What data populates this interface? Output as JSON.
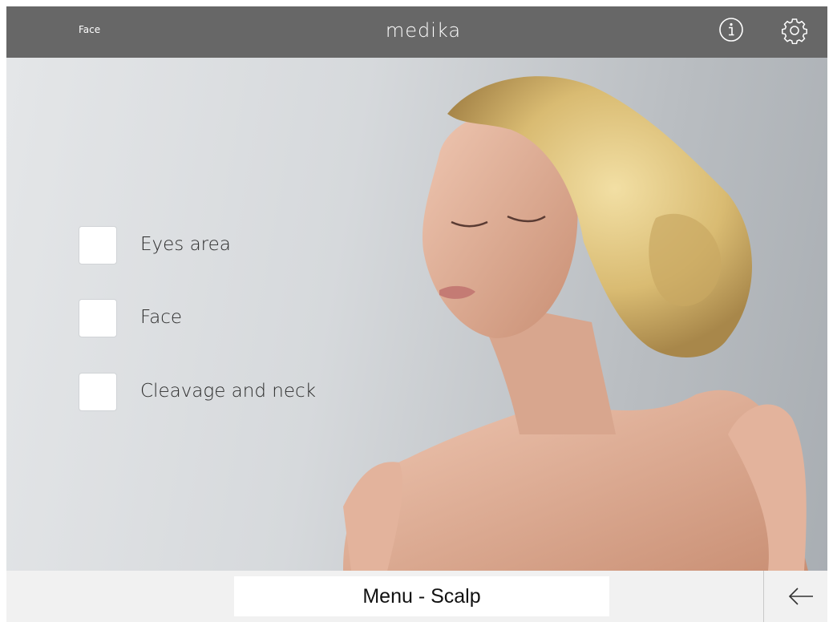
{
  "header": {
    "section_title": "Face",
    "logo_text": "medika",
    "info_icon": "info-icon",
    "settings_icon": "gear-icon"
  },
  "options": [
    {
      "label": "Eyes area",
      "checked": false
    },
    {
      "label": "Face",
      "checked": false
    },
    {
      "label": "Cleavage and neck",
      "checked": false
    }
  ],
  "footer": {
    "menu_label": "Menu - Scalp",
    "back_icon": "arrow-left-icon"
  },
  "colors": {
    "header_bg": "#676767",
    "footer_bg": "#f1f1f1",
    "hero_bg": "#cfd2d6"
  }
}
